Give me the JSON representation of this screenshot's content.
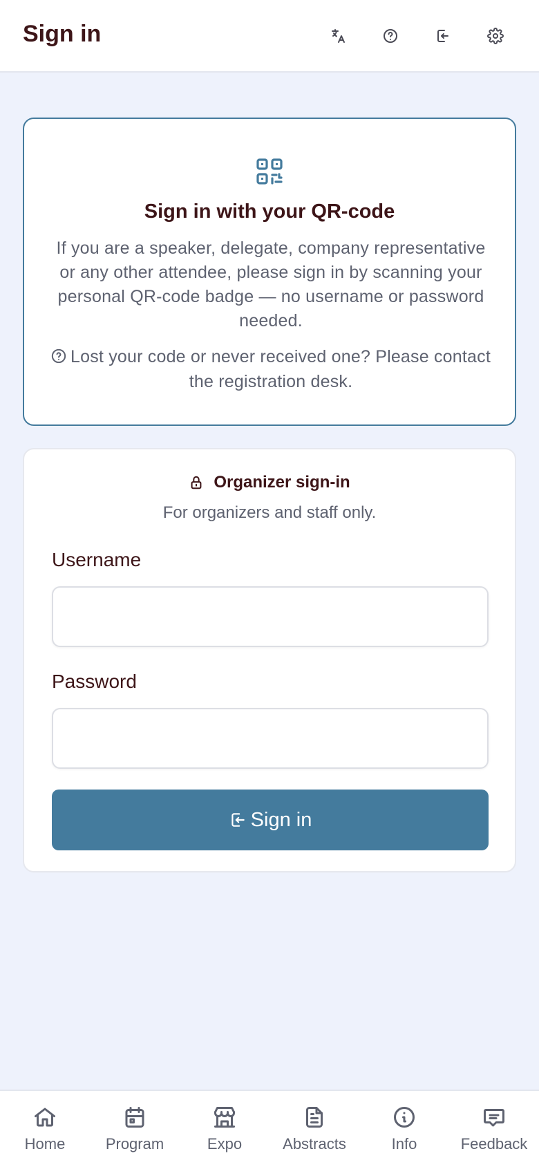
{
  "header": {
    "title": "Sign in",
    "icons": [
      "translate-icon",
      "help-icon",
      "login-icon",
      "settings-icon"
    ]
  },
  "qr_card": {
    "icon": "qr-code-icon",
    "title": "Sign in with your QR-code",
    "description": "If you are a speaker, delegate, company representative or any other attendee, please sign in by scanning your personal QR-code badge — no username or password needed.",
    "lost_code": "Lost your code or never received one? Please contact the registration desk."
  },
  "organizer": {
    "heading": "Organizer sign-in",
    "subtitle": "For organizers and staff only.",
    "username_label": "Username",
    "username_value": "",
    "password_label": "Password",
    "password_value": "",
    "button_label": "Sign in"
  },
  "nav": {
    "items": [
      {
        "label": "Home",
        "icon": "home-icon"
      },
      {
        "label": "Program",
        "icon": "calendar-icon"
      },
      {
        "label": "Expo",
        "icon": "store-icon"
      },
      {
        "label": "Abstracts",
        "icon": "document-icon"
      },
      {
        "label": "Info",
        "icon": "info-icon"
      },
      {
        "label": "Feedback",
        "icon": "message-icon"
      }
    ]
  },
  "colors": {
    "accent": "#447b9d",
    "heading": "#3d1518",
    "muted": "#5e6270",
    "background": "#eef2fc"
  }
}
